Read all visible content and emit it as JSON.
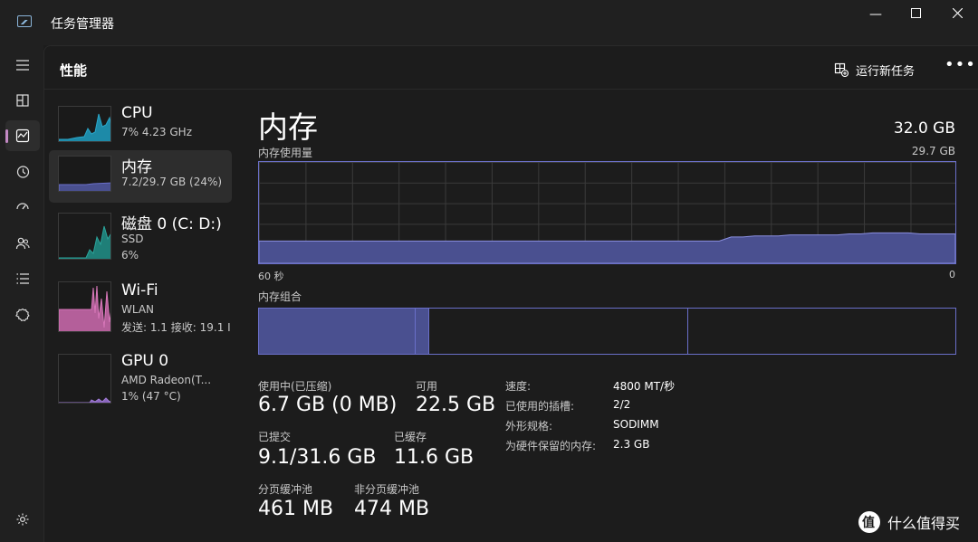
{
  "window": {
    "title": "任务管理器"
  },
  "nav": {
    "items": [
      {
        "icon": "hamburger-icon"
      },
      {
        "icon": "processes-icon"
      },
      {
        "icon": "performance-icon",
        "active": true
      },
      {
        "icon": "app-history-icon"
      },
      {
        "icon": "startup-apps-icon"
      },
      {
        "icon": "users-icon"
      },
      {
        "icon": "details-icon"
      },
      {
        "icon": "services-icon"
      },
      {
        "icon": "settings-icon"
      }
    ]
  },
  "header": {
    "title": "性能",
    "run_task_label": "运行新任务",
    "more_label": "•••"
  },
  "devices": [
    {
      "name": "CPU",
      "sub1": "7% 4.23 GHz",
      "sub2": "",
      "color": "#2aa6c9"
    },
    {
      "name": "内存",
      "sub1": "7.2/29.7 GB (24%)",
      "sub2": "",
      "color": "#6a6fc9"
    },
    {
      "name": "磁盘 0 (C: D:)",
      "sub1": "SSD",
      "sub2": "6%",
      "color": "#2aa39a"
    },
    {
      "name": "Wi-Fi",
      "sub1": "WLAN",
      "sub2": "发送: 1.1  接收: 19.1 I",
      "color": "#d777b9"
    },
    {
      "name": "GPU 0",
      "sub1": "AMD Radeon(T...",
      "sub2": "1% (47 °C)",
      "color": "#a07bd6"
    }
  ],
  "detail": {
    "title": "内存",
    "total": "32.0 GB",
    "usage_label": "内存使用量",
    "usage_max": "29.7 GB",
    "axis_left": "60 秒",
    "axis_right": "0",
    "composition_label": "内存组合",
    "usage_series": [
      0.22,
      0.22,
      0.22,
      0.22,
      0.22,
      0.22,
      0.22,
      0.22,
      0.22,
      0.22,
      0.22,
      0.22,
      0.22,
      0.22,
      0.22,
      0.22,
      0.22,
      0.22,
      0.22,
      0.22,
      0.22,
      0.22,
      0.22,
      0.22,
      0.22,
      0.22,
      0.22,
      0.22,
      0.22,
      0.22,
      0.22,
      0.22,
      0.22,
      0.22,
      0.22,
      0.22,
      0.22,
      0.22,
      0.22,
      0.22,
      0.26,
      0.26,
      0.27,
      0.27,
      0.27,
      0.28,
      0.28,
      0.28,
      0.28,
      0.28,
      0.29,
      0.29,
      0.3,
      0.3,
      0.3,
      0.3,
      0.29,
      0.29,
      0.29,
      0.29
    ],
    "stats": {
      "in_use_label": "使用中(已压缩)",
      "in_use_value": "6.7 GB (0 MB)",
      "available_label": "可用",
      "available_value": "22.5 GB",
      "committed_label": "已提交",
      "committed_value": "9.1/31.6 GB",
      "cached_label": "已缓存",
      "cached_value": "11.6 GB",
      "paged_label": "分页缓冲池",
      "paged_value": "461 MB",
      "nonpaged_label": "非分页缓冲池",
      "nonpaged_value": "474 MB"
    },
    "info": {
      "speed_label": "速度:",
      "speed_value": "4800 MT/秒",
      "slots_label": "已使用的插槽:",
      "slots_value": "2/2",
      "form_label": "外形规格:",
      "form_value": "SODIMM",
      "reserved_label": "为硬件保留的内存:",
      "reserved_value": "2.3 GB"
    }
  },
  "watermark": {
    "text": "什么值得买"
  }
}
